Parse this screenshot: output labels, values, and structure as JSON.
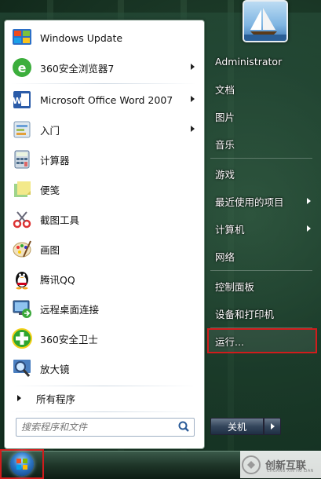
{
  "left_pane": {
    "programs": [
      {
        "label": "Windows Update",
        "icon": "windows-update-icon",
        "has_submenu": false
      },
      {
        "label": "360安全浏览器7",
        "icon": "360-browser-icon",
        "has_submenu": true
      },
      {
        "label": "Microsoft Office Word 2007",
        "icon": "word-icon",
        "has_submenu": true
      },
      {
        "label": "入门",
        "icon": "getting-started-icon",
        "has_submenu": true
      },
      {
        "label": "计算器",
        "icon": "calculator-icon",
        "has_submenu": false
      },
      {
        "label": "便笺",
        "icon": "sticky-notes-icon",
        "has_submenu": false
      },
      {
        "label": "截图工具",
        "icon": "snipping-tool-icon",
        "has_submenu": false
      },
      {
        "label": "画图",
        "icon": "paint-icon",
        "has_submenu": false
      },
      {
        "label": "腾讯QQ",
        "icon": "qq-penguin-icon",
        "has_submenu": false
      },
      {
        "label": "远程桌面连接",
        "icon": "remote-desktop-icon",
        "has_submenu": false
      },
      {
        "label": "360安全卫士",
        "icon": "360-safeguard-icon",
        "has_submenu": false
      },
      {
        "label": "放大镜",
        "icon": "magnifier-icon",
        "has_submenu": false
      }
    ],
    "all_programs_label": "所有程序",
    "search_placeholder": "搜索程序和文件"
  },
  "right_pane": {
    "user_name": "Administrator",
    "items": [
      {
        "label": "文档",
        "has_submenu": false
      },
      {
        "label": "图片",
        "has_submenu": false
      },
      {
        "label": "音乐",
        "has_submenu": false
      },
      {
        "label": "游戏",
        "has_submenu": false
      },
      {
        "label": "最近使用的项目",
        "has_submenu": true
      },
      {
        "label": "计算机",
        "has_submenu": true
      },
      {
        "label": "网络",
        "has_submenu": false
      },
      {
        "label": "控制面板",
        "has_submenu": false
      },
      {
        "label": "设备和打印机",
        "has_submenu": false
      },
      {
        "label": "运行...",
        "has_submenu": false,
        "highlighted": true
      }
    ],
    "shutdown_label": "关机"
  },
  "watermark": {
    "text": "创新互联",
    "sub": "CHUANG XIN HU LIAN"
  },
  "colors": {
    "highlight_outline": "#d11c1c",
    "menu_bg": "#ffffff",
    "right_text": "#ffffff"
  }
}
